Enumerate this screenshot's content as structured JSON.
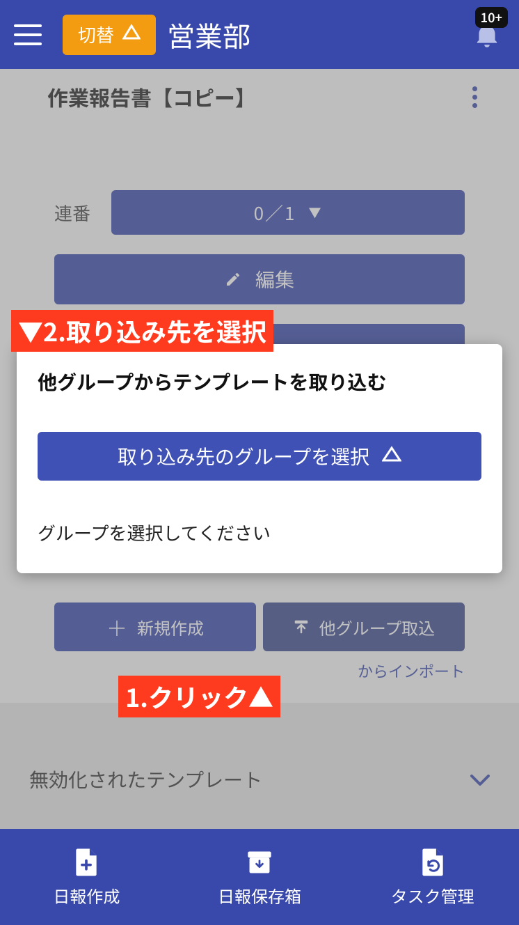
{
  "header": {
    "switch_label": "切替",
    "title": "営業部",
    "badge": "10+"
  },
  "report": {
    "title": "作業報告書【コピー】",
    "seq_label": "連番",
    "seq_value": "0／1",
    "edit_label": "編集"
  },
  "actions": {
    "new_label": "新規作成",
    "import_label": "他グループ取込",
    "import_link": "からインポート"
  },
  "disabled_section": {
    "label": "無効化されたテンプレート"
  },
  "dialog": {
    "title": "他グループからテンプレートを取り込む",
    "button_label": "取り込み先のグループを選択",
    "hint": "グループを選択してください"
  },
  "annotations": {
    "step2": "▼2.取り込み先を選択",
    "step1": "1.クリック▲"
  },
  "bottom_nav": {
    "item1": "日報作成",
    "item2": "日報保存箱",
    "item3": "タスク管理"
  }
}
